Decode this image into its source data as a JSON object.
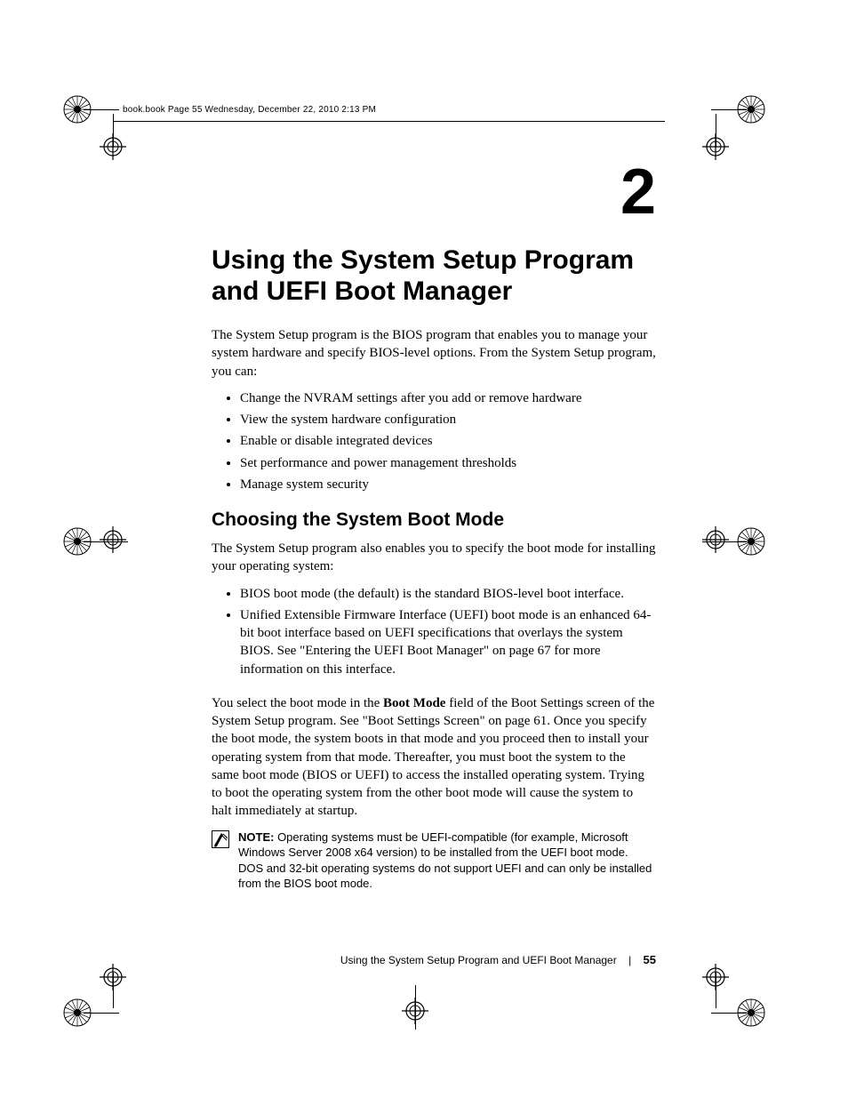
{
  "crop_header": "book.book  Page 55  Wednesday, December 22, 2010  2:13 PM",
  "chapter_number": "2",
  "title": "Using the System Setup Program and UEFI Boot Manager",
  "intro": "The System Setup program is the BIOS program that enables you to manage your system hardware and specify BIOS-level options. From the System Setup program, you can:",
  "intro_bullets": [
    "Change the NVRAM settings after you add or remove hardware",
    "View the system hardware configuration",
    "Enable or disable integrated devices",
    "Set performance and power management thresholds",
    "Manage system security"
  ],
  "section_heading": "Choosing the System Boot Mode",
  "section_intro": "The System Setup program also enables you to specify the boot mode for installing your operating system:",
  "section_bullets": [
    "BIOS boot mode (the default) is the standard BIOS-level boot interface.",
    "Unified Extensible Firmware Interface (UEFI) boot mode is an enhanced 64-bit boot interface based on UEFI specifications that overlays the system BIOS. See \"Entering the UEFI Boot Manager\" on page 67 for more information on this interface."
  ],
  "para_pre": "You select the boot mode in the ",
  "para_bold": "Boot Mode",
  "para_post": " field of the Boot Settings screen of the System Setup program. See \"Boot Settings Screen\" on page 61. Once you specify the boot mode, the system boots in that mode and you proceed then to install your operating system from that mode. Thereafter, you must boot the system to the same boot mode (BIOS or UEFI) to access the installed operating system. Trying to boot the operating system from the other boot mode will cause the system to halt immediately at startup.",
  "note_label": "NOTE: ",
  "note_text": "Operating systems must be UEFI-compatible (for example, Microsoft Windows Server 2008 x64 version) to be installed from the UEFI boot mode. DOS and 32-bit operating systems do not support UEFI and can only be installed from the BIOS boot mode.",
  "footer_title": "Using the System Setup Program and UEFI Boot Manager",
  "footer_sep": "|",
  "footer_page": "55"
}
